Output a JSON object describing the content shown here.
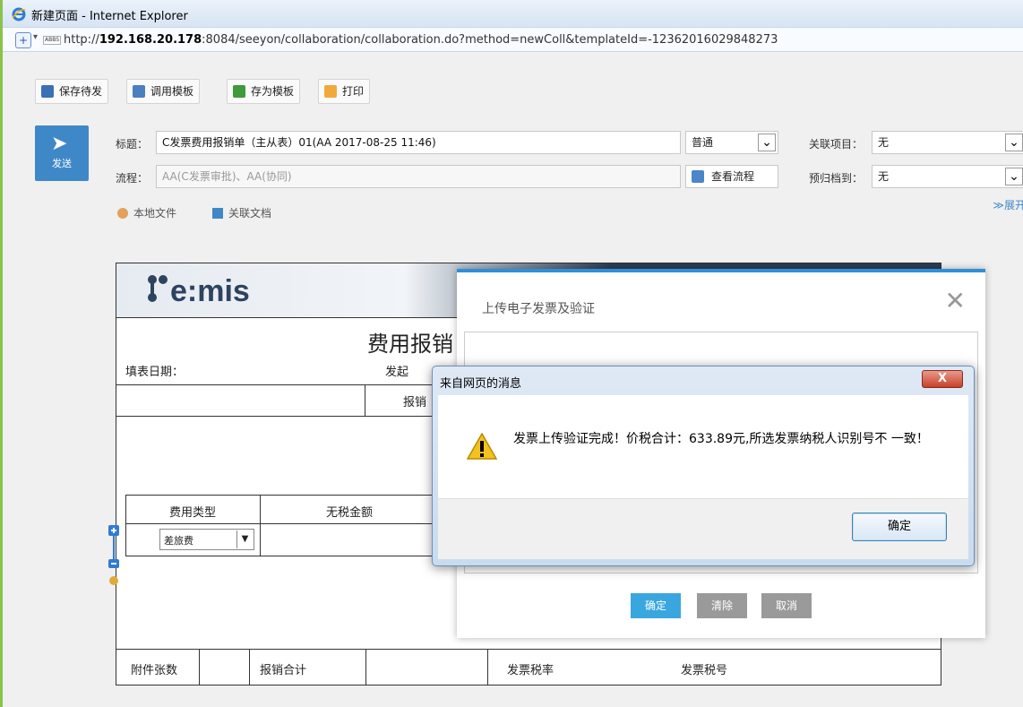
{
  "window": {
    "title": "新建页面 - Internet Explorer"
  },
  "address": {
    "url_prefix": "http://",
    "url_host": "192.168.20.178",
    "url_rest": ":8084/seeyon/collaboration/collaboration.do?method=newColl&templateId=-12362016029848273",
    "page_icon_text": "ABBS"
  },
  "toolbar": {
    "save_draft": "保存待发",
    "use_template": "调用模板",
    "save_template": "存为模板",
    "print": "打印"
  },
  "header": {
    "send_label": "发送",
    "subject_label": "标题：",
    "subject_value": "C发票费用报销单（主从表）01(AA 2017-08-25 11:46)",
    "priority_value": "普通",
    "related_project_label": "关联项目：",
    "related_project_value": "无",
    "flow_label": "流程：",
    "flow_value": "AA(C发票审批)、AA(协同)",
    "view_flow_label": "查看流程",
    "archive_label": "预归档到：",
    "archive_value": "无",
    "local_file_label": "本地文件",
    "related_doc_label": "关联文档",
    "expand_label": "展开"
  },
  "form": {
    "logo_text": "e:mis",
    "title": "费用报销",
    "fill_date_label": "填表日期：",
    "starter_label": "发起",
    "reimburser_label": "报销",
    "col_expense_type": "费用类型",
    "col_amount_no_tax": "无税金额",
    "row_expense_value": "差旅费",
    "attachments_label": "附件张数",
    "total_label": "报销合计",
    "tax_rate_label": "发票税率",
    "tax_no_label": "发票税号"
  },
  "upload_dialog": {
    "title": "上传电子发票及验证",
    "ok": "确定",
    "clear": "清除",
    "cancel": "取消"
  },
  "message_box": {
    "title": "来自网页的消息",
    "close": "X",
    "text": "发票上传验证完成！价税合计：633.89元,所选发票纳税人识别号不 一致！",
    "ok": "确定"
  },
  "colors": {
    "accent_blue": "#3f88c8",
    "dialog_top": "#2f8fd8",
    "ok_green": "#3aa6e0"
  }
}
